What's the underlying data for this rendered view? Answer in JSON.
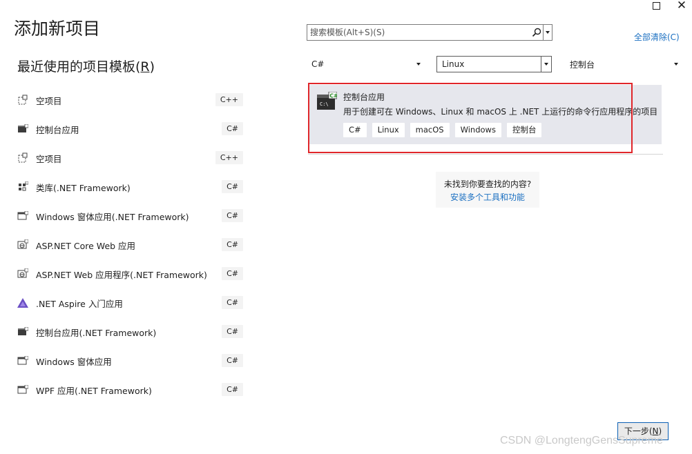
{
  "window": {
    "maximize_icon": "maximize-icon",
    "close_icon": "close-icon",
    "close_glyph": "✕"
  },
  "page": {
    "title": "添加新项目"
  },
  "recent": {
    "heading_prefix": "最近使用的项目模板(",
    "heading_accel": "R",
    "heading_suffix": ")",
    "items": [
      {
        "label": "空项目",
        "badge": "C++",
        "icon": "cpp-empty-project-icon"
      },
      {
        "label": "控制台应用",
        "badge": "C#",
        "icon": "console-app-icon"
      },
      {
        "label": "空项目",
        "badge": "C++",
        "icon": "cpp-empty-project-icon"
      },
      {
        "label": "类库(.NET Framework)",
        "badge": "C#",
        "icon": "class-library-icon"
      },
      {
        "label": "Windows 窗体应用(.NET Framework)",
        "badge": "C#",
        "icon": "windows-forms-icon"
      },
      {
        "label": "ASP.NET Core Web 应用",
        "badge": "C#",
        "icon": "web-app-icon"
      },
      {
        "label": "ASP.NET Web 应用程序(.NET Framework)",
        "badge": "C#",
        "icon": "web-app-icon"
      },
      {
        "label": ".NET Aspire 入门应用",
        "badge": "C#",
        "icon": "aspire-icon"
      },
      {
        "label": "控制台应用(.NET Framework)",
        "badge": "C#",
        "icon": "console-app-icon"
      },
      {
        "label": "Windows 窗体应用",
        "badge": "C#",
        "icon": "windows-forms-icon"
      },
      {
        "label": "WPF 应用(.NET Framework)",
        "badge": "C#",
        "icon": "wpf-icon"
      }
    ]
  },
  "search": {
    "placeholder": "搜索模板(Alt+S)(S)",
    "value": "",
    "icon": "search-icon",
    "dropdown_icon": "chevron-down-icon",
    "clear_all": "全部清除(C)"
  },
  "filters": {
    "language": "C#",
    "platform": "Linux",
    "project_type": "控制台"
  },
  "result": {
    "icon": "console-app-icon",
    "icon_text": "C:\\",
    "icon_badge": "C#",
    "title": "控制台应用",
    "description": "用于创建可在 Windows、Linux 和 macOS 上 .NET 上运行的命令行应用程序的项目",
    "tags": [
      "C#",
      "Linux",
      "macOS",
      "Windows",
      "控制台"
    ]
  },
  "not_found": {
    "question": "未找到你要查找的内容?",
    "link": "安装多个工具和功能"
  },
  "footer": {
    "next_prefix": "下一步(",
    "next_accel": "N",
    "next_suffix": ")",
    "watermark": "CSDN @LongtengGensSupreme"
  },
  "colors": {
    "accent": "#1a6fc1",
    "highlight": "#e0262a",
    "selected_bg": "#e6e7ed",
    "aspire": "#6b4fc4"
  }
}
